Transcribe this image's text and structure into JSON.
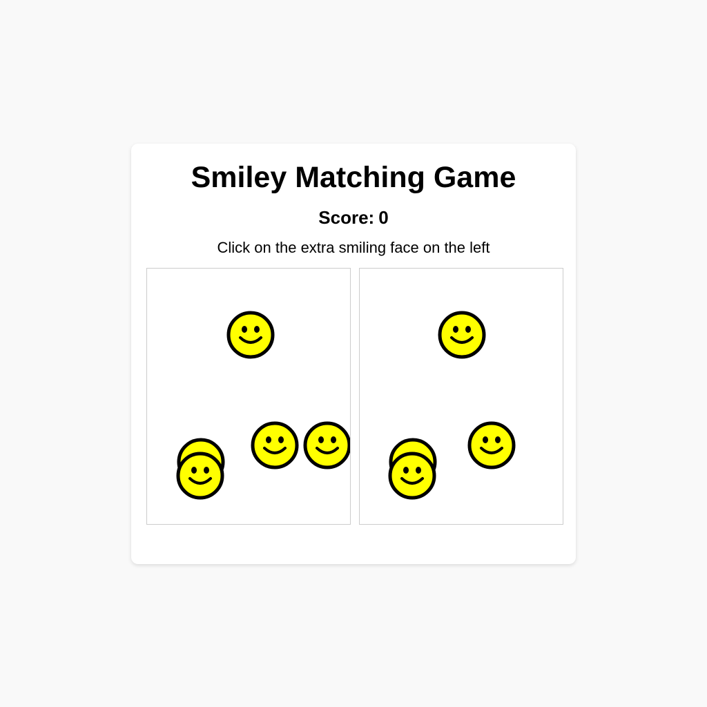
{
  "title": "Smiley Matching Game",
  "score": {
    "label": "Score:",
    "value": "0"
  },
  "instruction": "Click on the extra smiling face on the left",
  "colors": {
    "smiley_fill": "#ffff00",
    "smiley_stroke": "#000000",
    "panel_border": "#cccccc",
    "page_background": "#f9f9f9"
  },
  "panels": [
    {
      "side": "left",
      "smiley_count": 5,
      "icon": "smiley-face-icon"
    },
    {
      "side": "right",
      "smiley_count": 4,
      "icon": "smiley-face-icon"
    }
  ]
}
